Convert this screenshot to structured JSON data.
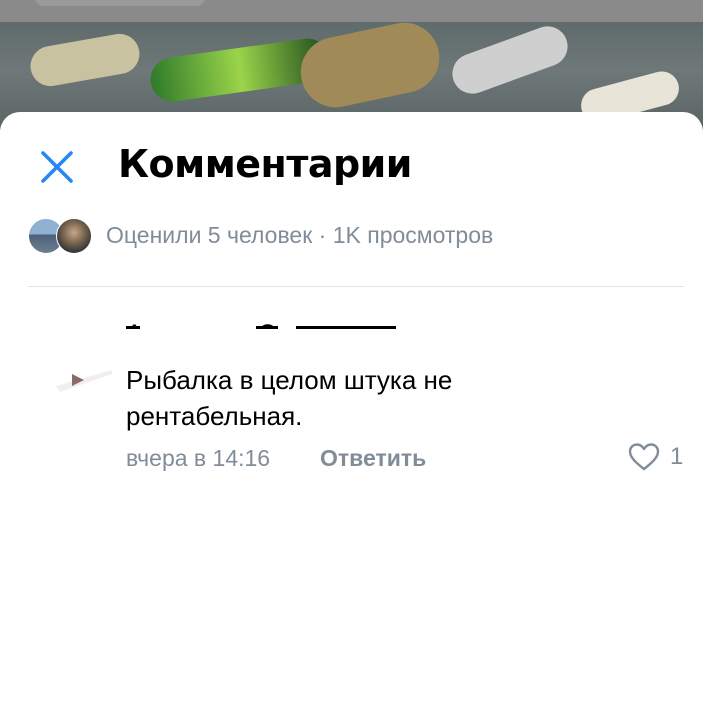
{
  "header": {
    "title": "Комментарии",
    "close_icon": "close-icon"
  },
  "stats": {
    "text": "Оценили 5 человек · 1K просмотров"
  },
  "comment": {
    "author": "Александр Сурков",
    "text": "Рыбалка в целом штука не рентабельная.",
    "time": "вчера в 14:16",
    "reply_label": "Ответить",
    "like_icon": "heart-icon",
    "like_count": "1"
  },
  "colors": {
    "accent": "#2787f5",
    "secondary_text": "#818c99",
    "divider": "#e1e3e6"
  }
}
